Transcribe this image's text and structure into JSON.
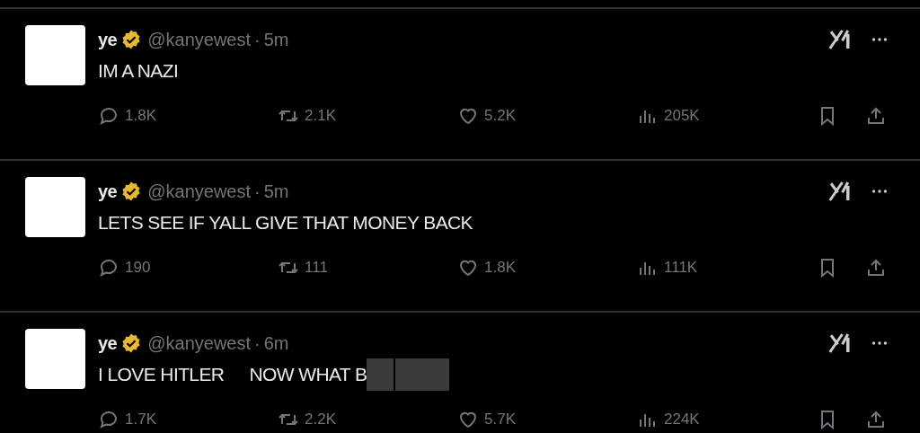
{
  "tweets": [
    {
      "name": "ye",
      "verified": true,
      "handle": "@kanyewest",
      "separator": "·",
      "time": "5m",
      "text": [
        "IM A NAZI"
      ],
      "redacted": false,
      "stats": {
        "replies": "1.8K",
        "reposts": "2.1K",
        "likes": "5.2K",
        "views": "205K"
      }
    },
    {
      "name": "ye",
      "verified": true,
      "handle": "@kanyewest",
      "separator": "·",
      "time": "5m",
      "text": [
        "LETS SEE IF YALL GIVE THAT MONEY BACK"
      ],
      "redacted": false,
      "stats": {
        "replies": "190",
        "reposts": "111",
        "likes": "1.8K",
        "views": "111K"
      }
    },
    {
      "name": "ye",
      "verified": true,
      "handle": "@kanyewest",
      "separator": "·",
      "time": "6m",
      "text": [
        "I LOVE HITLER",
        "NOW WHAT B"
      ],
      "redacted": true,
      "stats": {
        "replies": "1.7K",
        "reposts": "2.2K",
        "likes": "5.7K",
        "views": "224K"
      }
    }
  ]
}
